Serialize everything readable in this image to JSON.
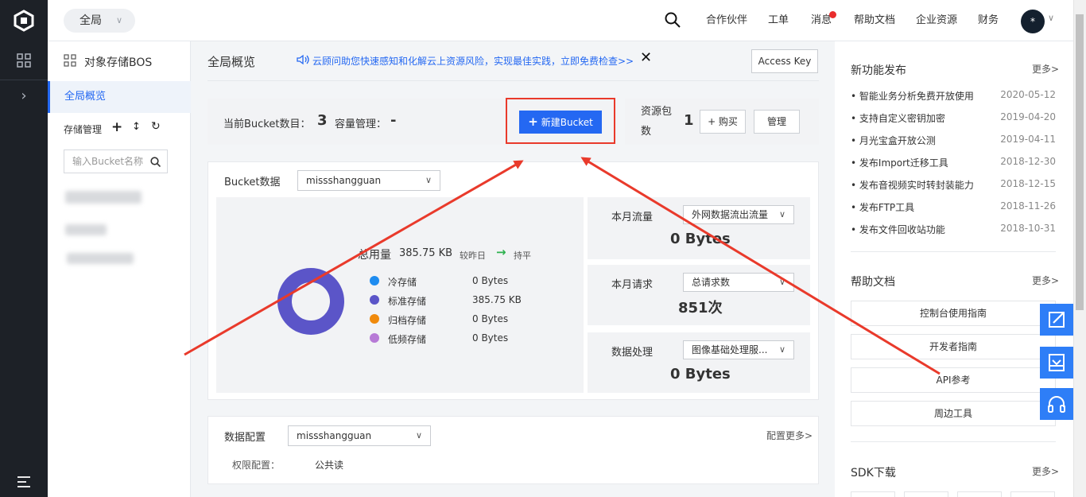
{
  "topbar": {
    "scope": "全局",
    "nav": [
      "合作伙伴",
      "工单",
      "消息",
      "帮助文档",
      "企业资源",
      "财务"
    ],
    "avatar": "*"
  },
  "sidebar": {
    "title": "对象存储BOS",
    "active_item": "全局概览",
    "storage_label": "存储管理",
    "search_placeholder": "输入Bucket名称"
  },
  "header": {
    "title": "全局概览",
    "notice": "云顾问助您快速感知和化解云上资源风险，实现最佳实践，立即免费检查>>",
    "access_key": "Access Key"
  },
  "summary": {
    "bucket_count_label": "当前Bucket数目：",
    "bucket_count": "3",
    "capacity_label": "容量管理：",
    "capacity_value": "-",
    "new_bucket": "新建Bucket",
    "package_label": "资源包数",
    "package_count": "1",
    "buy": "+ 购买",
    "manage": "管理"
  },
  "bucket_data": {
    "label": "Bucket数据",
    "selected": "missshangguan",
    "total_label": "总用量",
    "total_value": "385.75 KB",
    "compare_label": "较昨日",
    "trend": "持平",
    "legend": [
      {
        "name": "冷存储",
        "value": "0 Bytes",
        "color": "#1e8cf0"
      },
      {
        "name": "标准存储",
        "value": "385.75 KB",
        "color": "#5b55c8"
      },
      {
        "name": "归档存储",
        "value": "0 Bytes",
        "color": "#f08a0c"
      },
      {
        "name": "低频存储",
        "value": "0 Bytes",
        "color": "#b77ad6"
      }
    ],
    "stats": [
      {
        "label": "本月流量",
        "select": "外网数据流出流量",
        "value": "0 Bytes"
      },
      {
        "label": "本月请求",
        "select": "总请求数",
        "value": "851次"
      },
      {
        "label": "数据处理",
        "select": "图像基础处理服...",
        "value": "0 Bytes"
      }
    ]
  },
  "data_config": {
    "label": "数据配置",
    "selected": "missshangguan",
    "more": "配置更多>",
    "perm_label": "权限配置：",
    "perm_value": "公共读"
  },
  "right": {
    "news_title": "新功能发布",
    "news_more": "更多>",
    "news": [
      {
        "title": "智能业务分析免费开放使用",
        "date": "2020-05-12"
      },
      {
        "title": "支持自定义密钥加密",
        "date": "2019-04-20"
      },
      {
        "title": "月光宝盒开放公测",
        "date": "2019-04-11"
      },
      {
        "title": "发布Import迁移工具",
        "date": "2018-12-30"
      },
      {
        "title": "发布音视频实时转封装能力",
        "date": "2018-12-15"
      },
      {
        "title": "发布FTP工具",
        "date": "2018-11-26"
      },
      {
        "title": "发布文件回收站功能",
        "date": "2018-10-31"
      }
    ],
    "docs_title": "帮助文档",
    "docs_more": "更多>",
    "docs": [
      "控制台使用指南",
      "开发者指南",
      "API参考",
      "周边工具"
    ],
    "sdk_title": "SDK下载",
    "sdk_more": "更多>"
  },
  "colors": {
    "accent": "#2468f2",
    "annotation": "#e93a2b",
    "donut": "#5b55c8"
  }
}
